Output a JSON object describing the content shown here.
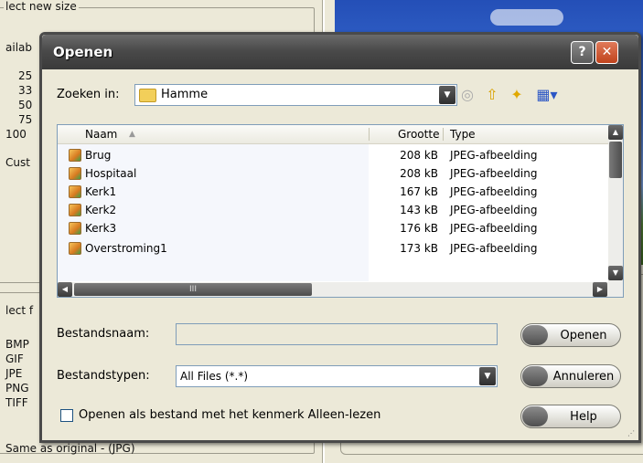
{
  "background": {
    "group1_legend": "lect new size",
    "group1_label": "ailab",
    "size_items": [
      "25",
      "33",
      "50",
      "75",
      "100"
    ],
    "custom_label": "Cust",
    "group2_label": "lect f",
    "format_items": [
      "BMP",
      "GIF",
      "JPE",
      "PNG",
      "TIFF"
    ],
    "bottom_text": "Same as original - (JPG)"
  },
  "dialog": {
    "title": "Openen",
    "help_glyph": "?",
    "close_glyph": "✕",
    "lookin_label": "Zoeken in:",
    "lookin_value": "Hamme",
    "toolbar_icons": [
      "back-icon",
      "up-folder-icon",
      "new-folder-icon",
      "view-menu-icon"
    ],
    "columns": [
      "Naam",
      "Grootte",
      "Type"
    ],
    "files": [
      {
        "name": "Brug",
        "size": "208 kB",
        "type": "JPEG-afbeelding"
      },
      {
        "name": "Hospitaal",
        "size": "208 kB",
        "type": "JPEG-afbeelding"
      },
      {
        "name": "Kerk1",
        "size": "167 kB",
        "type": "JPEG-afbeelding"
      },
      {
        "name": "Kerk2",
        "size": "143 kB",
        "type": "JPEG-afbeelding"
      },
      {
        "name": "Kerk3",
        "size": "176 kB",
        "type": "JPEG-afbeelding"
      },
      {
        "name": "Overstroming1",
        "size": "173 kB",
        "type": "JPEG-afbeelding"
      }
    ],
    "hscroll_thumb_glyph": "III",
    "filename_label": "Bestandsnaam:",
    "filename_value": "",
    "filetype_label": "Bestandstypen:",
    "filetype_value": "All Files (*.*)",
    "readonly_label": "Openen als bestand met het kenmerk Alleen-lezen",
    "open_button": "Openen",
    "cancel_button": "Annuleren",
    "help_button": "Help"
  }
}
